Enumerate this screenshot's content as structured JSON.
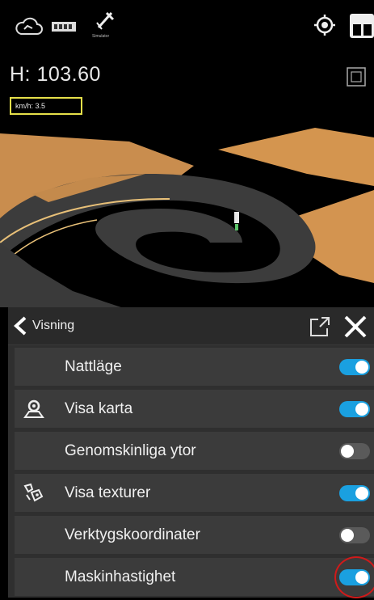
{
  "viewport": {
    "height_readout": "H: 103.60",
    "speed_label": "km/h: 3.5",
    "simulator_caption": "Simulator"
  },
  "icons": {
    "cloud": "cloud-icon",
    "battery": "battery-icon",
    "satellite": "satellite-icon",
    "gps_target": "gps-target-icon",
    "layout": "layout-icon",
    "view_cube": "view-cube-icon"
  },
  "panel": {
    "title": "Visning",
    "items": [
      {
        "label": "Nattläge",
        "icon": null,
        "enabled": true
      },
      {
        "label": "Visa karta",
        "icon": "map-pin-icon",
        "enabled": true
      },
      {
        "label": "Genomskinliga ytor",
        "icon": null,
        "enabled": false
      },
      {
        "label": "Visa texturer",
        "icon": "texture-icon",
        "enabled": true
      },
      {
        "label": "Verktygskoordinater",
        "icon": null,
        "enabled": false
      },
      {
        "label": "Maskinhastighet",
        "icon": null,
        "enabled": true
      }
    ]
  },
  "colors": {
    "toggle_on": "#1aa0e0",
    "toggle_off": "#5a5a5a",
    "speed_box_border": "#e6e04a",
    "highlight_ring": "#d01a1a",
    "surface": "#d89a5a"
  }
}
